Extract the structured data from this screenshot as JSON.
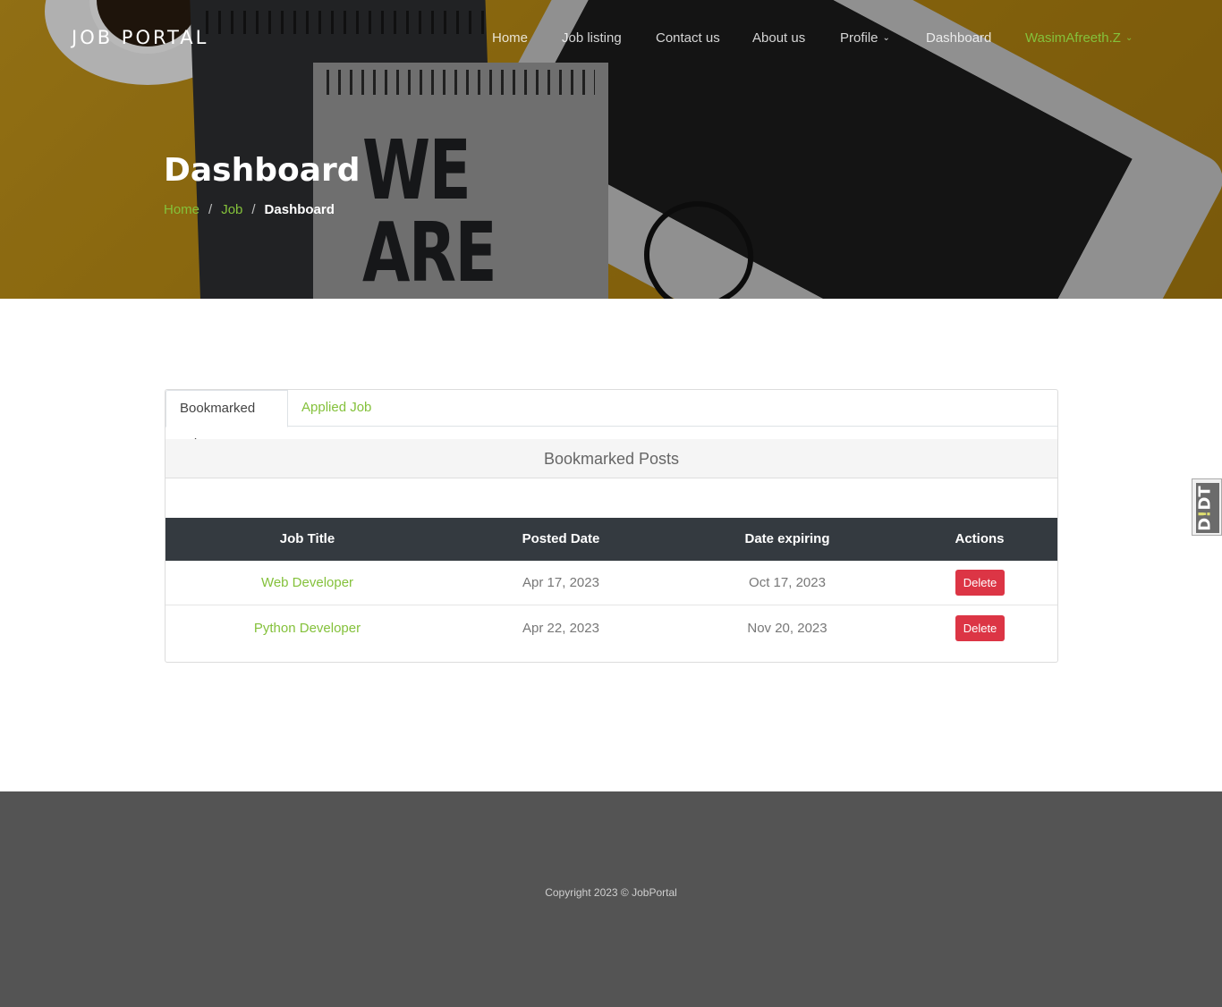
{
  "nav": {
    "brand": "JOB PORTAL",
    "links": [
      "Home",
      "Job listing",
      "Contact us",
      "About us",
      "Profile",
      "Dashboard"
    ],
    "user": "WasimAfreeth.Z",
    "chevron": "⌄"
  },
  "hero": {
    "title": "Dashboard",
    "photo_text": "WE\nARE",
    "breadcrumb": {
      "home": "Home",
      "sep": "/",
      "job": "Job",
      "current": "Dashboard"
    }
  },
  "tabs": [
    "Bookmarked Job",
    "Applied Job"
  ],
  "panel": {
    "heading": "Bookmarked Posts",
    "columns": [
      "Job Title",
      "Posted Date",
      "Date expiring",
      "Actions"
    ],
    "rows": [
      {
        "title": "Web Developer",
        "posted": "Apr 17, 2023",
        "expiring": "Oct 17, 2023",
        "action": "Delete"
      },
      {
        "title": "Python Developer",
        "posted": "Apr 22, 2023",
        "expiring": "Nov 20, 2023",
        "action": "Delete"
      }
    ]
  },
  "side_tab": {
    "label_a": "D",
    "label_b": "!",
    "label_c": "DT"
  },
  "footer": {
    "copyright": "Copyright 2023 © JobPortal"
  },
  "colors": {
    "accent": "#84c13b",
    "danger": "#dc3545",
    "table_head": "#343a40",
    "footer": "#545454"
  }
}
